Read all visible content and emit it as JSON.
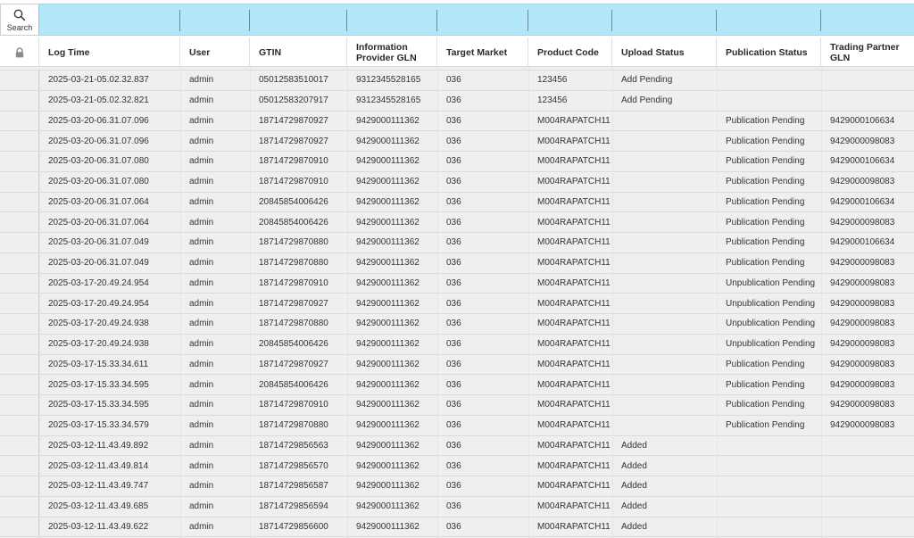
{
  "toolbar": {
    "search_label": "Search"
  },
  "columns": [
    "",
    "Log Time",
    "User",
    "GTIN",
    "Information Provider GLN",
    "Target Market",
    "Product Code",
    "Upload Status",
    "Publication Status",
    "Trading Partner GLN"
  ],
  "rows": [
    [
      "2025-03-21-05.02.32.837",
      "admin",
      "05012583510017",
      "9312345528165",
      "036",
      "123456",
      "Add Pending",
      "",
      ""
    ],
    [
      "2025-03-21-05.02.32.821",
      "admin",
      "05012583207917",
      "9312345528165",
      "036",
      "123456",
      "Add Pending",
      "",
      ""
    ],
    [
      "2025-03-20-06.31.07.096",
      "admin",
      "18714729870927",
      "9429000111362",
      "036",
      "M004RAPATCH11",
      "",
      "Publication Pending",
      "9429000106634"
    ],
    [
      "2025-03-20-06.31.07.096",
      "admin",
      "18714729870927",
      "9429000111362",
      "036",
      "M004RAPATCH11",
      "",
      "Publication Pending",
      "9429000098083"
    ],
    [
      "2025-03-20-06.31.07.080",
      "admin",
      "18714729870910",
      "9429000111362",
      "036",
      "M004RAPATCH11",
      "",
      "Publication Pending",
      "9429000106634"
    ],
    [
      "2025-03-20-06.31.07.080",
      "admin",
      "18714729870910",
      "9429000111362",
      "036",
      "M004RAPATCH11",
      "",
      "Publication Pending",
      "9429000098083"
    ],
    [
      "2025-03-20-06.31.07.064",
      "admin",
      "20845854006426",
      "9429000111362",
      "036",
      "M004RAPATCH11",
      "",
      "Publication Pending",
      "9429000106634"
    ],
    [
      "2025-03-20-06.31.07.064",
      "admin",
      "20845854006426",
      "9429000111362",
      "036",
      "M004RAPATCH11",
      "",
      "Publication Pending",
      "9429000098083"
    ],
    [
      "2025-03-20-06.31.07.049",
      "admin",
      "18714729870880",
      "9429000111362",
      "036",
      "M004RAPATCH11",
      "",
      "Publication Pending",
      "9429000106634"
    ],
    [
      "2025-03-20-06.31.07.049",
      "admin",
      "18714729870880",
      "9429000111362",
      "036",
      "M004RAPATCH11",
      "",
      "Publication Pending",
      "9429000098083"
    ],
    [
      "2025-03-17-20.49.24.954",
      "admin",
      "18714729870910",
      "9429000111362",
      "036",
      "M004RAPATCH11",
      "",
      "Unpublication Pending",
      "9429000098083"
    ],
    [
      "2025-03-17-20.49.24.954",
      "admin",
      "18714729870927",
      "9429000111362",
      "036",
      "M004RAPATCH11",
      "",
      "Unpublication Pending",
      "9429000098083"
    ],
    [
      "2025-03-17-20.49.24.938",
      "admin",
      "18714729870880",
      "9429000111362",
      "036",
      "M004RAPATCH11",
      "",
      "Unpublication Pending",
      "9429000098083"
    ],
    [
      "2025-03-17-20.49.24.938",
      "admin",
      "20845854006426",
      "9429000111362",
      "036",
      "M004RAPATCH11",
      "",
      "Unpublication Pending",
      "9429000098083"
    ],
    [
      "2025-03-17-15.33.34.611",
      "admin",
      "18714729870927",
      "9429000111362",
      "036",
      "M004RAPATCH11",
      "",
      "Publication Pending",
      "9429000098083"
    ],
    [
      "2025-03-17-15.33.34.595",
      "admin",
      "20845854006426",
      "9429000111362",
      "036",
      "M004RAPATCH11",
      "",
      "Publication Pending",
      "9429000098083"
    ],
    [
      "2025-03-17-15.33.34.595",
      "admin",
      "18714729870910",
      "9429000111362",
      "036",
      "M004RAPATCH11",
      "",
      "Publication Pending",
      "9429000098083"
    ],
    [
      "2025-03-17-15.33.34.579",
      "admin",
      "18714729870880",
      "9429000111362",
      "036",
      "M004RAPATCH11",
      "",
      "Publication Pending",
      "9429000098083"
    ],
    [
      "2025-03-12-11.43.49.892",
      "admin",
      "18714729856563",
      "9429000111362",
      "036",
      "M004RAPATCH11",
      "Added",
      "",
      ""
    ],
    [
      "2025-03-12-11.43.49.814",
      "admin",
      "18714729856570",
      "9429000111362",
      "036",
      "M004RAPATCH11",
      "Added",
      "",
      ""
    ],
    [
      "2025-03-12-11.43.49.747",
      "admin",
      "18714729856587",
      "9429000111362",
      "036",
      "M004RAPATCH11",
      "Added",
      "",
      ""
    ],
    [
      "2025-03-12-11.43.49.685",
      "admin",
      "18714729856594",
      "9429000111362",
      "036",
      "M004RAPATCH11",
      "Added",
      "",
      ""
    ],
    [
      "2025-03-12-11.43.49.622",
      "admin",
      "18714729856600",
      "9429000111362",
      "036",
      "M004RAPATCH11",
      "Added",
      "",
      ""
    ]
  ]
}
